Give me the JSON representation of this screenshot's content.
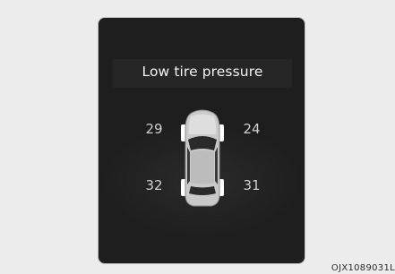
{
  "display": {
    "title": "Low tire pressure",
    "tires": {
      "front_left": "29",
      "front_right": "24",
      "rear_left": "32",
      "rear_right": "31"
    }
  },
  "caption": "OJX1089031L"
}
